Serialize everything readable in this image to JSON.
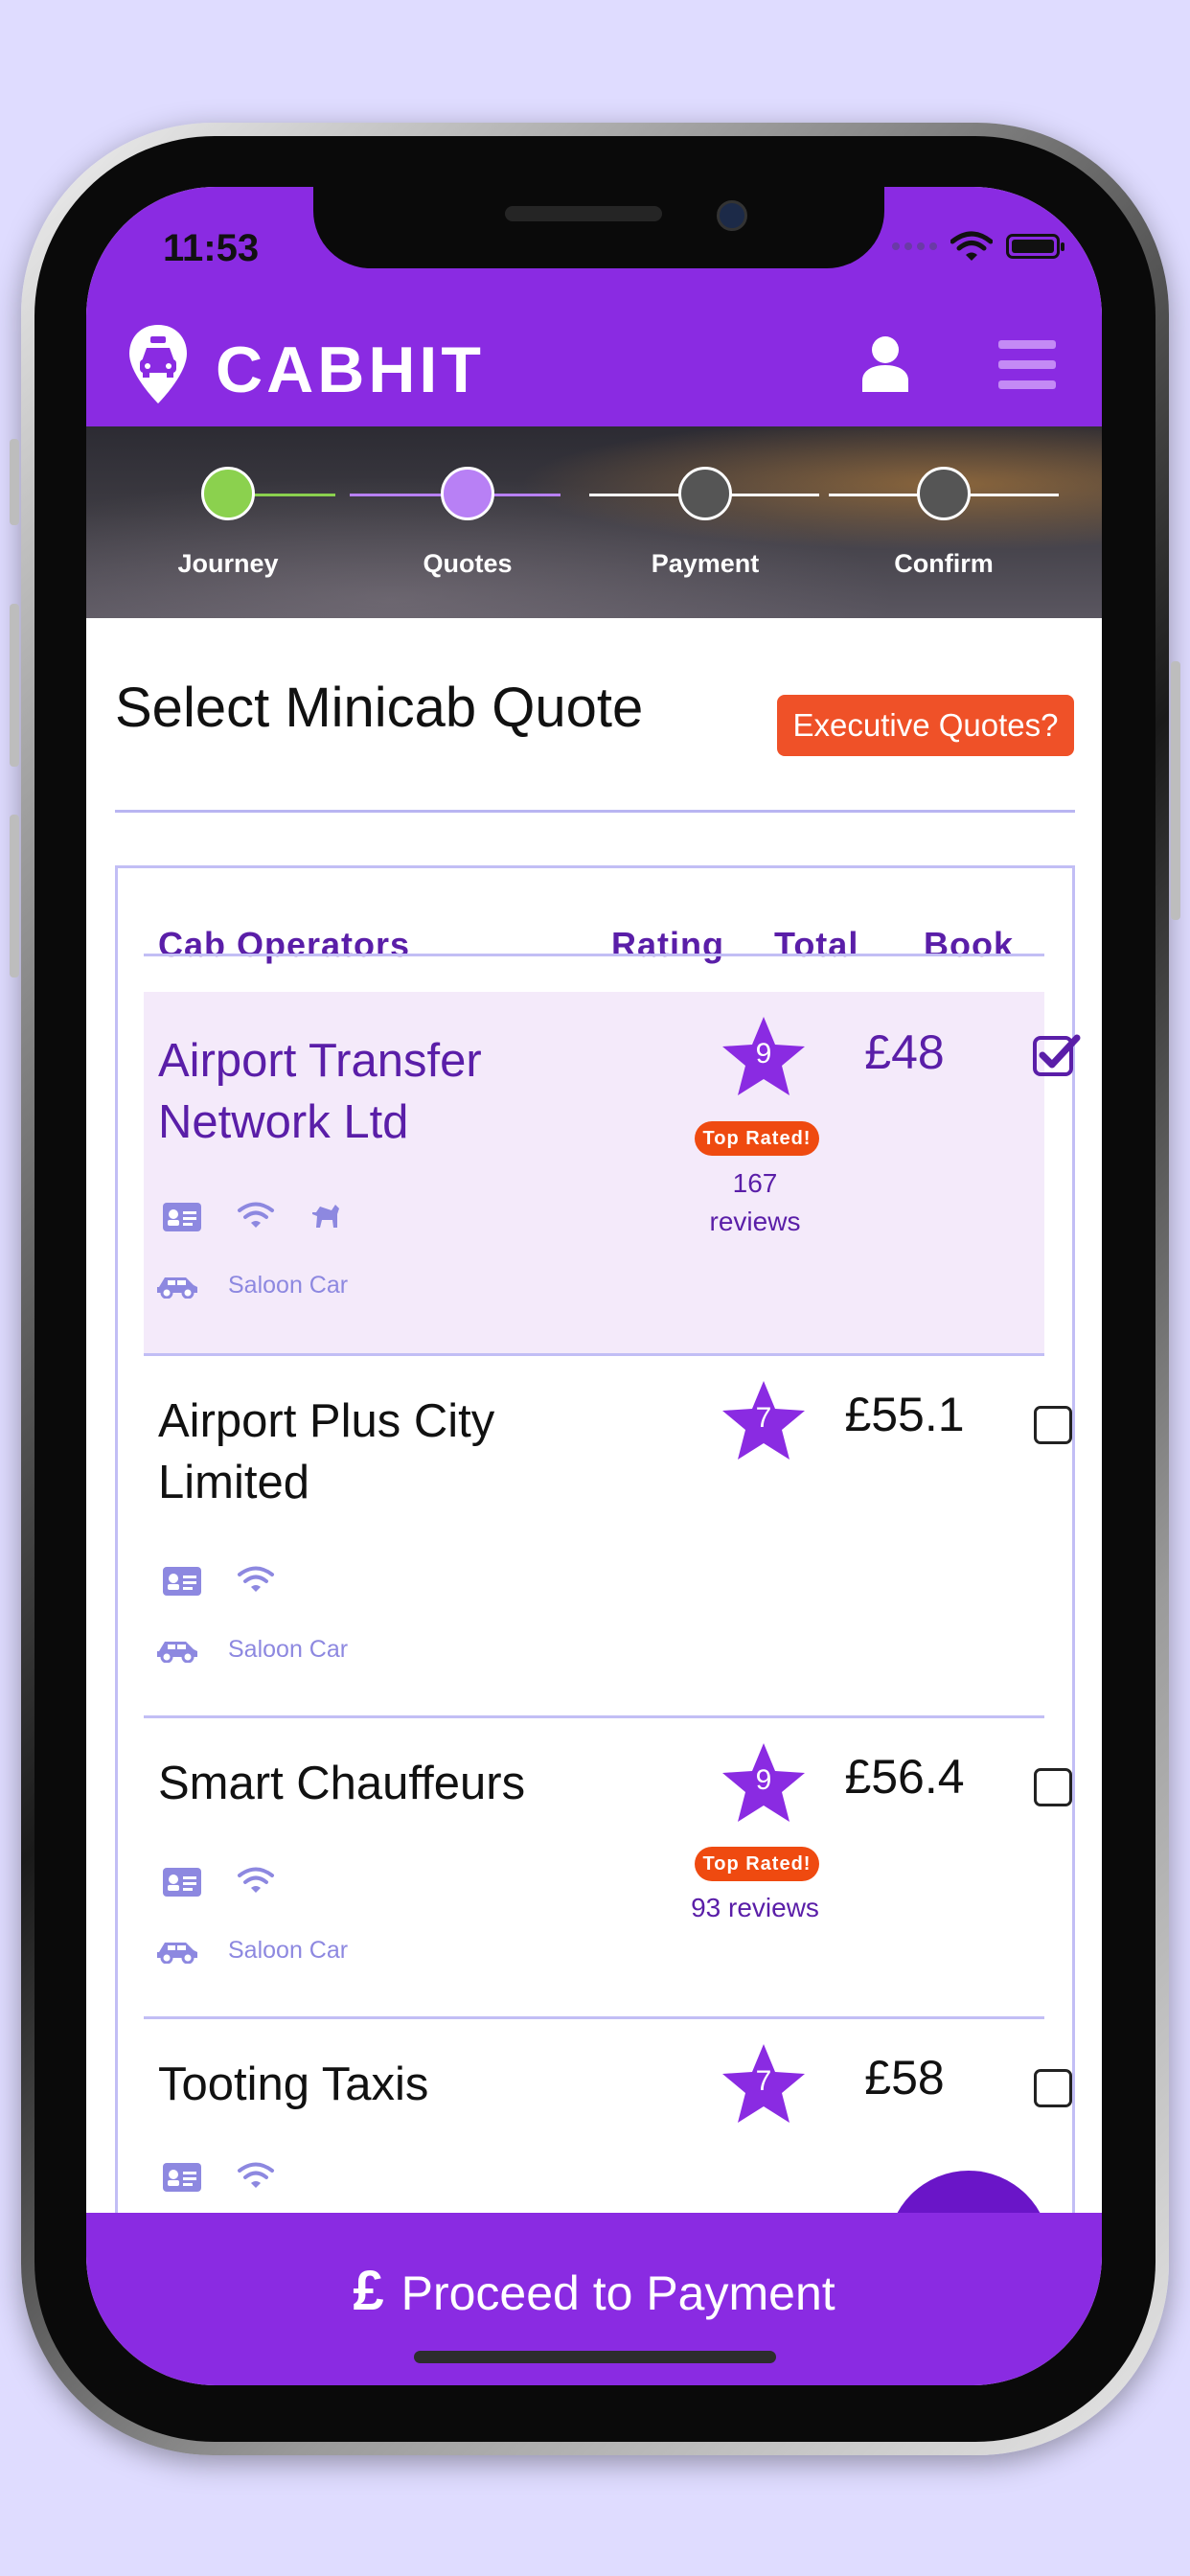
{
  "status_bar": {
    "time": "11:53"
  },
  "header": {
    "brand": "CABHIT"
  },
  "steps": [
    {
      "label": "Journey",
      "state": "done"
    },
    {
      "label": "Quotes",
      "state": "active"
    },
    {
      "label": "Payment",
      "state": "pending"
    },
    {
      "label": "Confirm",
      "state": "pending"
    }
  ],
  "main": {
    "title": "Select Minicab Quote",
    "executive_button": "Executive Quotes?"
  },
  "table": {
    "headers": {
      "operator": "Cab Operators",
      "rating": "Rating",
      "total": "Total",
      "book": "Book"
    },
    "rows": [
      {
        "name": "Airport Transfer Network Ltd",
        "rating": "9",
        "top_rated": "Top Rated!",
        "reviews": "167 reviews",
        "price": "£48",
        "vehicle": "Saloon Car",
        "selected": true,
        "features": [
          "id-card-icon",
          "wifi-icon",
          "pet-friendly-icon"
        ]
      },
      {
        "name": "Airport Plus City Limited",
        "rating": "7",
        "price": "£55.1",
        "vehicle": "Saloon Car",
        "selected": false,
        "features": [
          "id-card-icon",
          "wifi-icon"
        ]
      },
      {
        "name": "Smart Chauffeurs",
        "rating": "9",
        "top_rated": "Top Rated!",
        "reviews": "93 reviews",
        "price": "£56.4",
        "vehicle": "Saloon Car",
        "selected": false,
        "features": [
          "id-card-icon",
          "wifi-icon"
        ]
      },
      {
        "name": "Tooting Taxis",
        "rating": "7",
        "price": "£58",
        "selected": false,
        "features": [
          "id-card-icon",
          "wifi-icon"
        ]
      }
    ]
  },
  "footer": {
    "currency_symbol": "£",
    "proceed_label": "Proceed to Payment"
  },
  "colors": {
    "brand_purple": "#8a2be2",
    "accent_orange": "#ef5128",
    "text_purple": "#5a1ea8",
    "selected_row": "#f4eafa"
  }
}
